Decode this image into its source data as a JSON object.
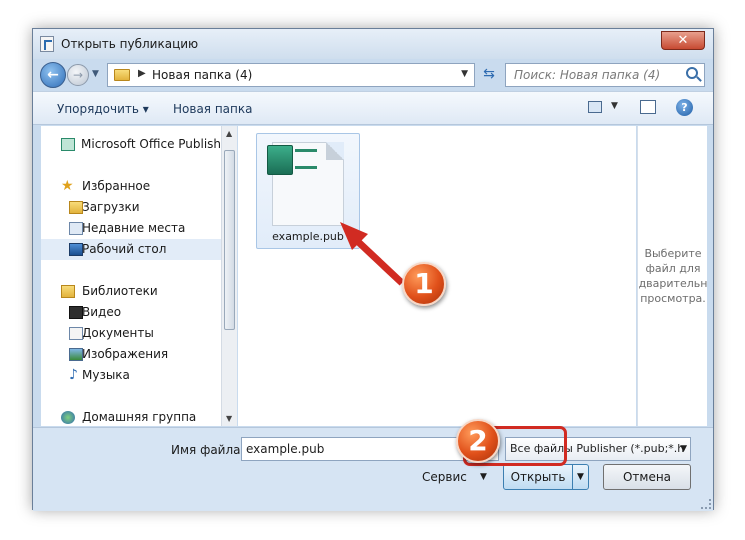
{
  "window": {
    "title": "Открыть публикацию",
    "close_glyph": "✕"
  },
  "nav": {
    "back_glyph": "←",
    "forward_glyph": "→",
    "address": "Новая папка (4)",
    "refresh_glyph": "⇆",
    "search_placeholder": "Поиск: Новая папка (4)"
  },
  "toolbar": {
    "organize_label": "Упорядочить ▾",
    "new_folder_label": "Новая папка",
    "help_glyph": "?"
  },
  "sidebar": {
    "items": [
      {
        "label": "Microsoft Office Publisher",
        "icon": "publisher-icon"
      },
      {
        "label": "Избранное",
        "icon": "star-icon"
      },
      {
        "label": "Загрузки",
        "icon": "downloads-icon"
      },
      {
        "label": "Недавние места",
        "icon": "recent-places-icon"
      },
      {
        "label": "Рабочий стол",
        "icon": "desktop-icon"
      },
      {
        "label": "Библиотеки",
        "icon": "libraries-icon"
      },
      {
        "label": "Видео",
        "icon": "video-icon"
      },
      {
        "label": "Документы",
        "icon": "documents-icon"
      },
      {
        "label": "Изображения",
        "icon": "pictures-icon"
      },
      {
        "label": "Музыка",
        "icon": "music-icon"
      },
      {
        "label": "Домашняя группа",
        "icon": "homegroup-icon"
      }
    ]
  },
  "files": [
    {
      "name": "example.pub",
      "icon": "publisher-file-icon"
    }
  ],
  "preview": {
    "line1": "Выберите",
    "line2": "файл для",
    "line3": "дварительн",
    "line4": "просмотра."
  },
  "bottom": {
    "filename_label": "Имя файла:",
    "filename_value": "example.pub",
    "filter_value": "Все файлы Publisher (*.pub;*.h",
    "service_label": "Сервис",
    "open_label": "Открыть",
    "cancel_label": "Отмена"
  },
  "annotations": {
    "marker1": "1",
    "marker2": "2",
    "accent_color": "#d12b22"
  }
}
